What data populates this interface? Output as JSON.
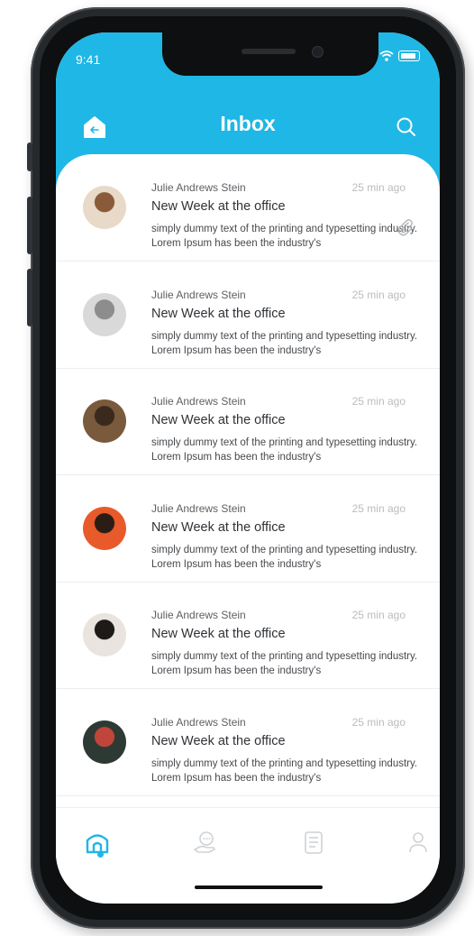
{
  "status": {
    "time": "9:41"
  },
  "header": {
    "title": "Inbox"
  },
  "messages": [
    {
      "sender": "Julie Andrews Stein",
      "time_ago": "25 min ago",
      "subject": "New Week at the office",
      "preview": "simply dummy text of the printing and typesetting industry. Lorem Ipsum has been the industry's",
      "has_attachment": true,
      "avatar_colors": [
        "#e9d9c8",
        "#8a5b3a"
      ]
    },
    {
      "sender": "Julie Andrews Stein",
      "time_ago": "25 min ago",
      "subject": "New Week at the office",
      "preview": "simply dummy text of the printing and typesetting industry. Lorem Ipsum has been the industry's",
      "has_attachment": false,
      "avatar_colors": [
        "#d9d9d9",
        "#8d8d8d"
      ]
    },
    {
      "sender": "Julie Andrews Stein",
      "time_ago": "25 min ago",
      "subject": "New Week at the office",
      "preview": "simply dummy text of the printing and typesetting industry. Lorem Ipsum has been the industry's",
      "has_attachment": false,
      "avatar_colors": [
        "#7a5a3c",
        "#3a2a1e"
      ]
    },
    {
      "sender": "Julie Andrews Stein",
      "time_ago": "25 min ago",
      "subject": "New Week at the office",
      "preview": "simply dummy text of the printing and typesetting industry. Lorem Ipsum has been the industry's",
      "has_attachment": false,
      "avatar_colors": [
        "#e85a2a",
        "#2b1d16"
      ]
    },
    {
      "sender": "Julie Andrews Stein",
      "time_ago": "25 min ago",
      "subject": "New Week at the office",
      "preview": "simply dummy text of the printing and typesetting industry. Lorem Ipsum has been the industry's",
      "has_attachment": false,
      "avatar_colors": [
        "#e9e4df",
        "#1e1a18"
      ]
    },
    {
      "sender": "Julie Andrews Stein",
      "time_ago": "25 min ago",
      "subject": "New Week at the office",
      "preview": "simply dummy text of the printing and typesetting industry. Lorem Ipsum has been the industry's",
      "has_attachment": false,
      "avatar_colors": [
        "#2c3a33",
        "#c0453a"
      ]
    }
  ],
  "tabbar": {
    "items": [
      {
        "icon": "home-icon",
        "active": true
      },
      {
        "icon": "chat-hand-icon",
        "active": false
      },
      {
        "icon": "document-icon",
        "active": false
      },
      {
        "icon": "profile-icon",
        "active": false
      }
    ]
  },
  "colors": {
    "accent": "#1fb7e5",
    "text_dark": "#2f3236",
    "text_muted": "#b9bcbf"
  }
}
